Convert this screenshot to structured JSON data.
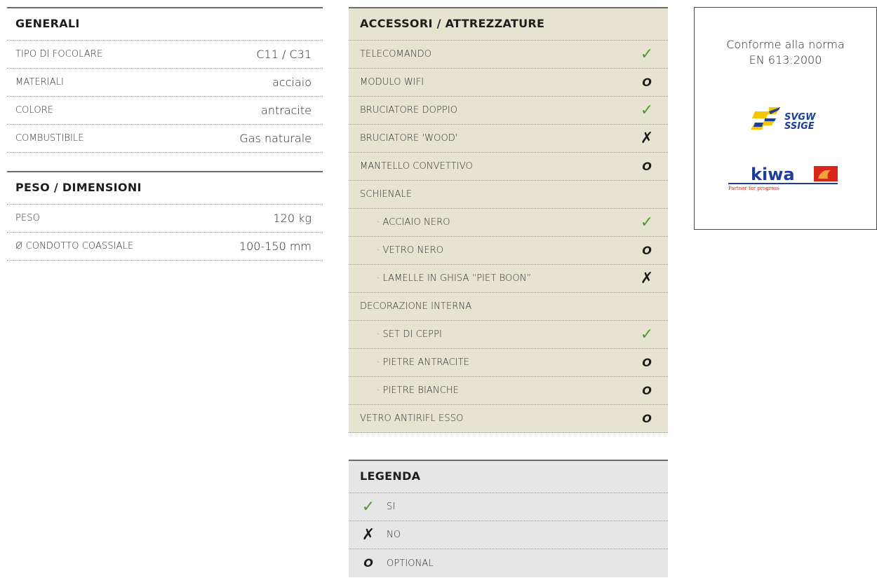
{
  "generali": {
    "title": "GENERALI",
    "rows": [
      {
        "label": "TIPO DI FOCOLARE",
        "value": "C11 / C31"
      },
      {
        "label": "MATERIALI",
        "value": "acciaio"
      },
      {
        "label": "COLORE",
        "value": "antracite"
      },
      {
        "label": "COMBUSTIBILE",
        "value": "Gas naturale"
      }
    ]
  },
  "peso": {
    "title": "PESO / DIMENSIONI",
    "rows": [
      {
        "label": "PESO",
        "value": "120 kg"
      },
      {
        "label": "Ø CONDOTTO COASSIALE",
        "value": "100-150 mm"
      }
    ]
  },
  "accessori": {
    "title": "ACCESSORI / ATTREZZATURE",
    "rows": [
      {
        "label": "TELECOMANDO",
        "mark": "✓"
      },
      {
        "label": "MODULO WIFI",
        "mark": "O"
      },
      {
        "label": "BRUCIATORE DOPPIO",
        "mark": "✓"
      },
      {
        "label": "BRUCIATORE 'WOOD'",
        "mark": "✗"
      },
      {
        "label": "MANTELLO CONVETTIVO",
        "mark": "O"
      },
      {
        "label": "SCHIENALE",
        "mark": ""
      },
      {
        "label": "· ACCIAIO NERO",
        "mark": "✓"
      },
      {
        "label": "· VETRO NERO",
        "mark": "O"
      },
      {
        "label": "· LAMELLE IN GHISA “PIET BOON”",
        "mark": "✗"
      },
      {
        "label": "DECORAZIONE INTERNA",
        "mark": ""
      },
      {
        "label": "· SET DI CEPPI",
        "mark": "✓"
      },
      {
        "label": "· PIETRE ANTRACITE",
        "mark": "O"
      },
      {
        "label": "· PIETRE BIANCHE",
        "mark": "O"
      },
      {
        "label": "VETRO ANTIRIFL ESSO",
        "mark": "O"
      }
    ]
  },
  "legenda": {
    "title": "LEGENDA",
    "rows": [
      {
        "mark": "✓",
        "label": "SI"
      },
      {
        "mark": "✗",
        "label": "NO"
      },
      {
        "mark": "O",
        "label": "OPTIONAL"
      }
    ]
  },
  "cert": {
    "line1": "Conforme alla norma",
    "line2": "EN 613:2000",
    "svgw_logo_text": "SVGW SSIGE",
    "kiwa_logo_text": "kiwa",
    "kiwa_tagline": "Partner for progress"
  },
  "colors": {
    "accent_green": "#4f9a2f",
    "accessori_bg": "#e6e3d1",
    "legenda_bg": "#e6e6e6",
    "svgw_yellow": "#f2c600",
    "svgw_blue": "#1d3f9a",
    "kiwa_red": "#d8261c"
  }
}
